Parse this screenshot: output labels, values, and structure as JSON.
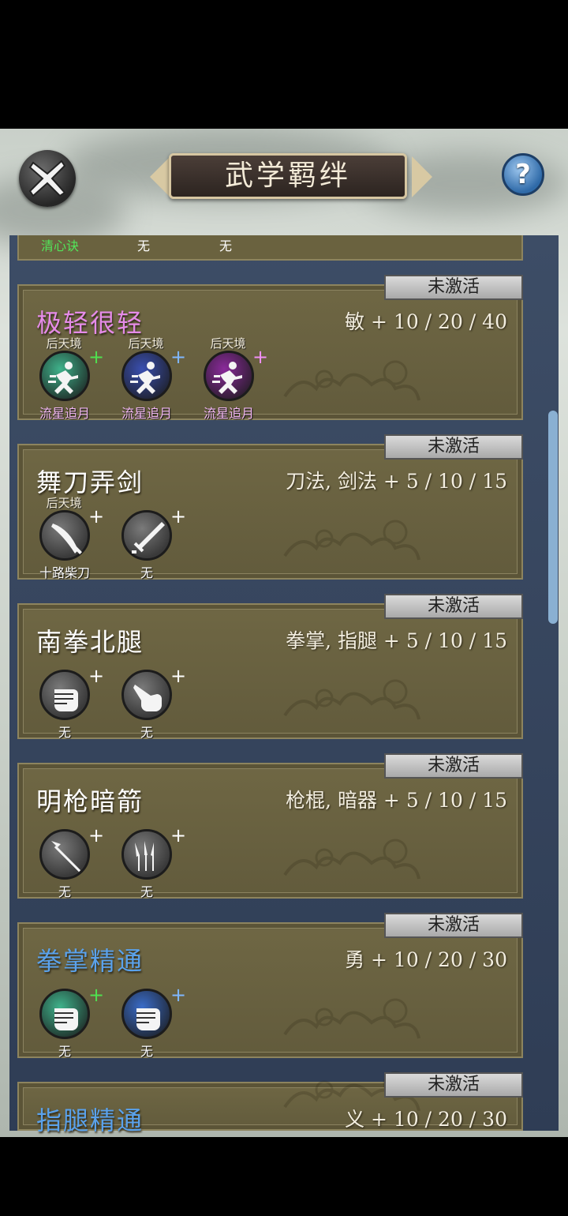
{
  "header": {
    "title": "武学羁绊",
    "help_glyph": "?"
  },
  "top_partial": {
    "name": "清心诀",
    "items": [
      "无",
      "无"
    ]
  },
  "status_label": "未激活",
  "cards": [
    {
      "name": "极轻很轻",
      "name_color": "#e58be8",
      "bonus": "敏 + 10 / 20 / 40",
      "slots": [
        {
          "realm": "后天境",
          "item": "流星追月",
          "item_color": "#f3b8f3",
          "icon": "running-icon",
          "disc": "#3fb28b",
          "plus": "#4fe04f"
        },
        {
          "realm": "后天境",
          "item": "流星追月",
          "item_color": "#f3b8f3",
          "icon": "running-icon",
          "disc": "#3a4fb0",
          "plus": "#7fb7ff"
        },
        {
          "realm": "后天境",
          "item": "流星追月",
          "item_color": "#f3b8f3",
          "icon": "running-icon",
          "disc": "#8a2a9a",
          "plus": "#ef8ff5"
        }
      ]
    },
    {
      "name": "舞刀弄剑",
      "name_color": "#ffffff",
      "bonus": "刀法, 剑法 + 5 / 10 / 15",
      "slots": [
        {
          "realm": "后天境",
          "item": "十路柴刀",
          "item_color": "#ffffff",
          "icon": "saber-icon",
          "disc": "",
          "plus": "#ffffff"
        },
        {
          "realm": "",
          "item": "无",
          "item_color": "#ffffff",
          "icon": "sword-icon",
          "disc": "",
          "plus": "#ffffff"
        }
      ]
    },
    {
      "name": "南拳北腿",
      "name_color": "#ffffff",
      "bonus": "拳掌, 指腿 + 5 / 10 / 15",
      "slots": [
        {
          "realm": "",
          "item": "无",
          "item_color": "#ffffff",
          "icon": "fist-icon",
          "disc": "",
          "plus": "#ffffff"
        },
        {
          "realm": "",
          "item": "无",
          "item_color": "#ffffff",
          "icon": "pointing-hand-icon",
          "disc": "",
          "plus": "#ffffff"
        }
      ]
    },
    {
      "name": "明枪暗箭",
      "name_color": "#ffffff",
      "bonus": "枪棍, 暗器 + 5 / 10 / 15",
      "slots": [
        {
          "realm": "",
          "item": "无",
          "item_color": "#ffffff",
          "icon": "spear-icon",
          "disc": "",
          "plus": "#ffffff"
        },
        {
          "realm": "",
          "item": "无",
          "item_color": "#ffffff",
          "icon": "darts-icon",
          "disc": "",
          "plus": "#ffffff"
        }
      ]
    },
    {
      "name": "拳掌精通",
      "name_color": "#5aa2ec",
      "bonus": "勇 + 10 / 20 / 30",
      "slots": [
        {
          "realm": "",
          "item": "无",
          "item_color": "#ffffff",
          "icon": "fist-icon",
          "disc": "#3fb28b",
          "plus": "#4fe04f"
        },
        {
          "realm": "",
          "item": "无",
          "item_color": "#ffffff",
          "icon": "fist-icon",
          "disc": "#3a6cc8",
          "plus": "#7fb7ff"
        }
      ]
    },
    {
      "name": "指腿精通",
      "name_color": "#5aa2ec",
      "bonus": "义 + 10 / 20 / 30",
      "slots": []
    }
  ]
}
